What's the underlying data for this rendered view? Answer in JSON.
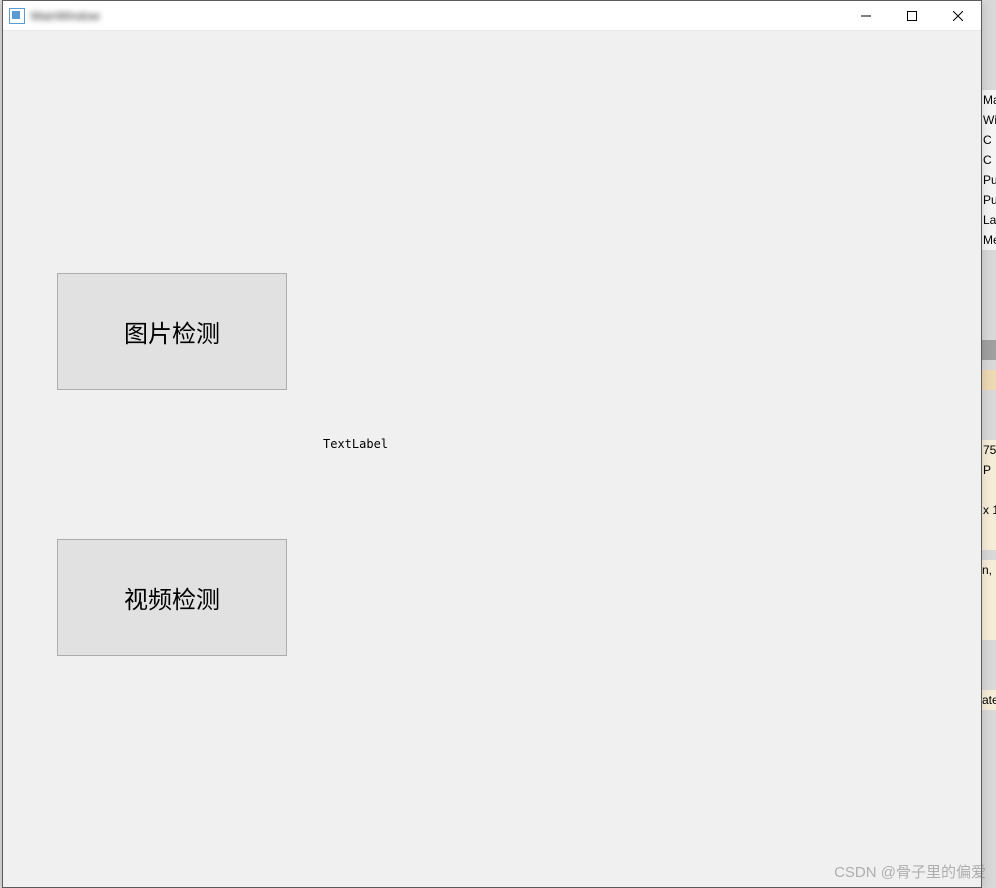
{
  "window": {
    "title": "MainWindow"
  },
  "buttons": {
    "image_detect": "图片检测",
    "video_detect": "视频检测"
  },
  "label": {
    "text": "TextLabel"
  },
  "behind": {
    "items_top": [
      "Ma",
      "Wi",
      "C",
      "C",
      "Pu",
      "Pu",
      "La",
      "Me"
    ],
    "mid1": "75",
    "mid2": "P",
    "mid3": "x 1",
    "mid4": "n,",
    "mid5": "ate"
  },
  "watermark": "CSDN @骨子里的偏爱"
}
